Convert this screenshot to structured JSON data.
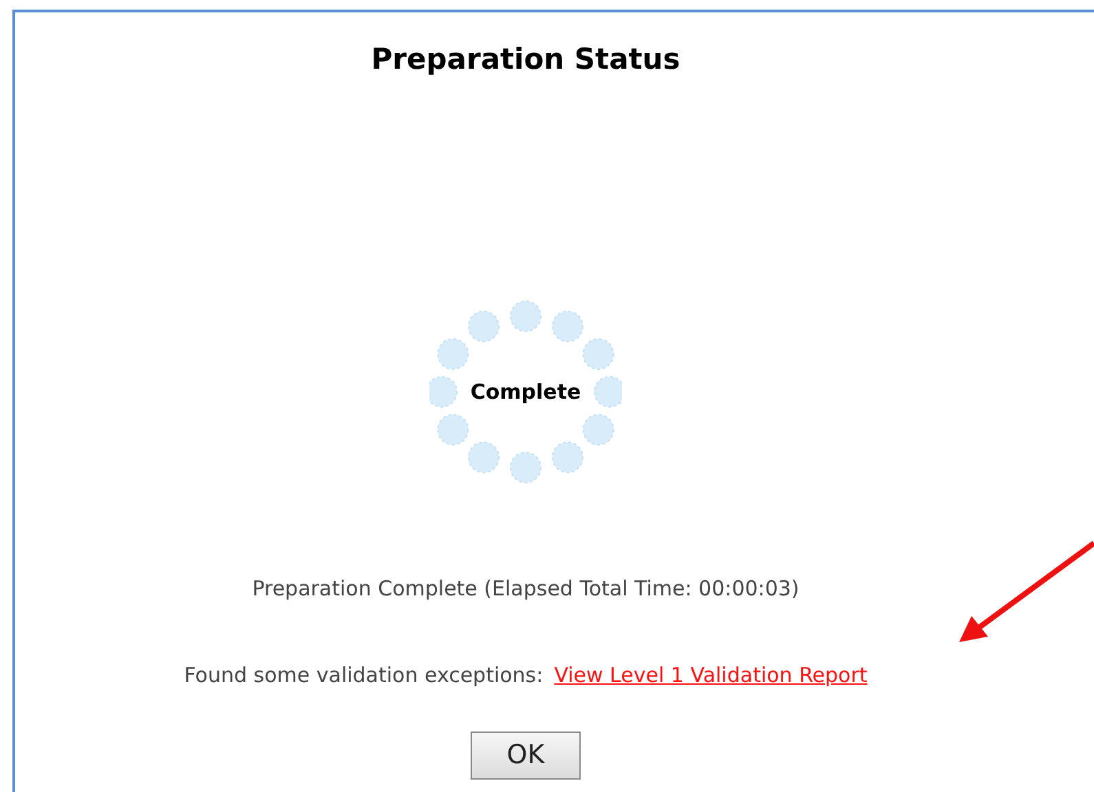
{
  "dialog": {
    "title": "Preparation Status",
    "spinner": {
      "label": "Complete"
    },
    "status_message": "Preparation Complete (Elapsed Total Time: 00:00:03)",
    "validation": {
      "message": "Found some validation exceptions:",
      "link": "View Level 1 Validation Report"
    },
    "buttons": [
      "OK"
    ]
  }
}
